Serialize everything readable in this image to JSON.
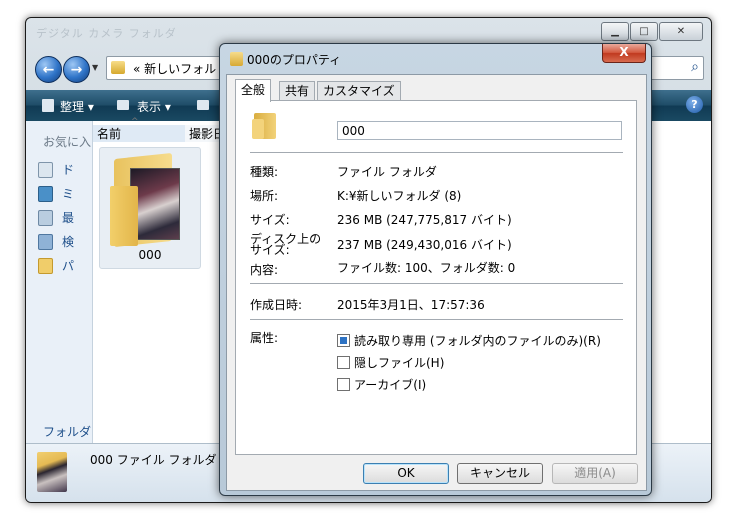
{
  "explorer": {
    "title": "デジタル カメラ フォルダ",
    "address": "« 新しいフォル",
    "commands": [
      "整理 ▾",
      "表示 ▾"
    ],
    "favorites_label": "お気に入",
    "nav_items": [
      "ド",
      "ミ",
      "最",
      "検",
      "パ"
    ],
    "folders_label": "フォルダ",
    "columns": {
      "name": "名前",
      "date": "撮影日"
    },
    "item_label": "000",
    "details_text": "000 ファイル フォルダ"
  },
  "dialog": {
    "title": "000のプロパティ",
    "close_glyph": "X",
    "tabs": [
      "全般",
      "共有",
      "カスタマイズ"
    ],
    "name_value": "000",
    "rows": [
      {
        "label": "種類:",
        "value": "ファイル フォルダ"
      },
      {
        "label": "場所:",
        "value": "K:¥新しいフォルダ (8)"
      },
      {
        "label": "サイズ:",
        "value": "236 MB (247,775,817 バイト)"
      },
      {
        "label": "ディスク上のサイズ:",
        "value": "237 MB (249,430,016 バイト)"
      },
      {
        "label": "内容:",
        "value": "ファイル数: 100、フォルダ数: 0"
      },
      {
        "label": "作成日時:",
        "value": "2015年3月1日、17:57:36"
      },
      {
        "label": "属性:",
        "value": ""
      }
    ],
    "attributes": [
      {
        "label": "読み取り専用 (フォルダ内のファイルのみ)(R)",
        "checked": true
      },
      {
        "label": "隠しファイル(H)",
        "checked": false
      },
      {
        "label": "アーカイブ(I)",
        "checked": false
      }
    ],
    "buttons": {
      "ok": "OK",
      "cancel": "キャンセル",
      "apply": "適用(A)"
    }
  }
}
